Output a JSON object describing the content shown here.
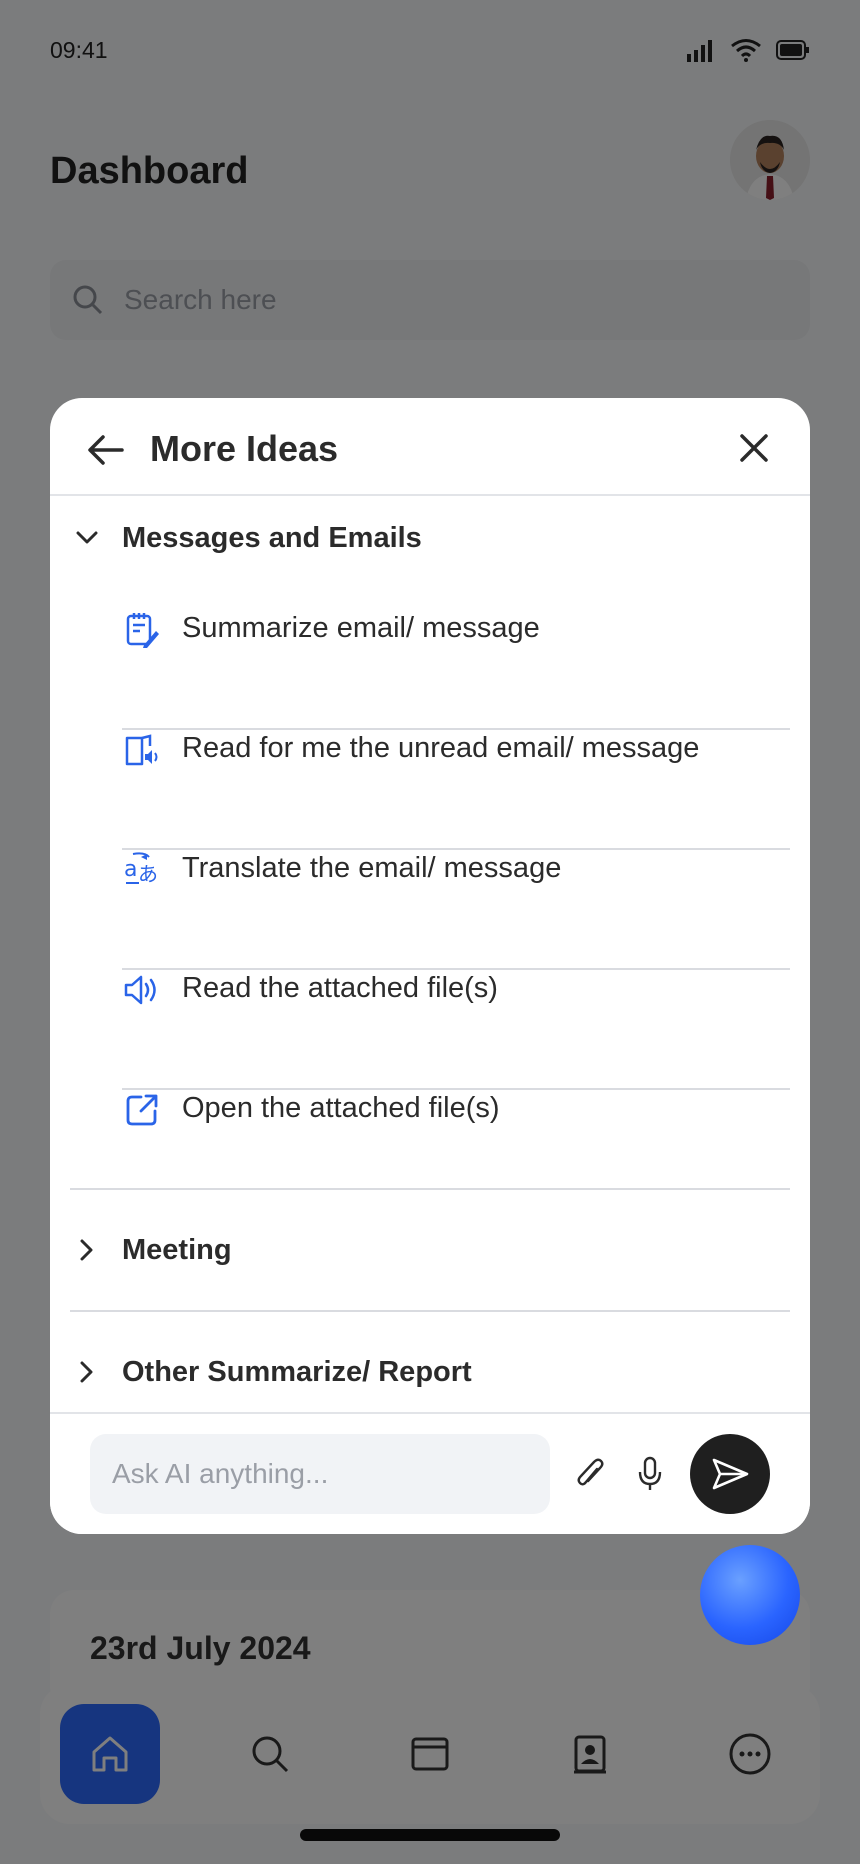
{
  "status_bar": {
    "time": "09:41"
  },
  "header": {
    "title": "Dashboard"
  },
  "search": {
    "placeholder": "Search here"
  },
  "date_card": {
    "date": "23rd July 2024"
  },
  "modal": {
    "title": "More Ideas",
    "sections": [
      {
        "label": "Messages and Emails",
        "expanded": true,
        "items": [
          {
            "label": "Summarize email/ message",
            "icon": "note-edit-icon"
          },
          {
            "label": "Read for me the unread email/ message",
            "icon": "read-aloud-book-icon"
          },
          {
            "label": "Translate the email/ message",
            "icon": "translate-icon"
          },
          {
            "label": "Read the attached file(s)",
            "icon": "speaker-icon"
          },
          {
            "label": "Open the attached file(s)",
            "icon": "open-external-icon"
          }
        ]
      },
      {
        "label": "Meeting",
        "expanded": false
      },
      {
        "label": "Other Summarize/ Report",
        "expanded": false
      }
    ]
  },
  "chat_input": {
    "placeholder": "Ask AI anything..."
  },
  "bottom_nav": {
    "items": [
      "home-icon",
      "search-icon",
      "window-icon",
      "contacts-icon",
      "more-icon"
    ],
    "active": "home-icon"
  },
  "colors": {
    "accent": "#2d6bff",
    "icon_blue": "#2a64e8",
    "send_button": "#1f1f1f",
    "overlay": "rgba(0,0,0,0.5)"
  }
}
